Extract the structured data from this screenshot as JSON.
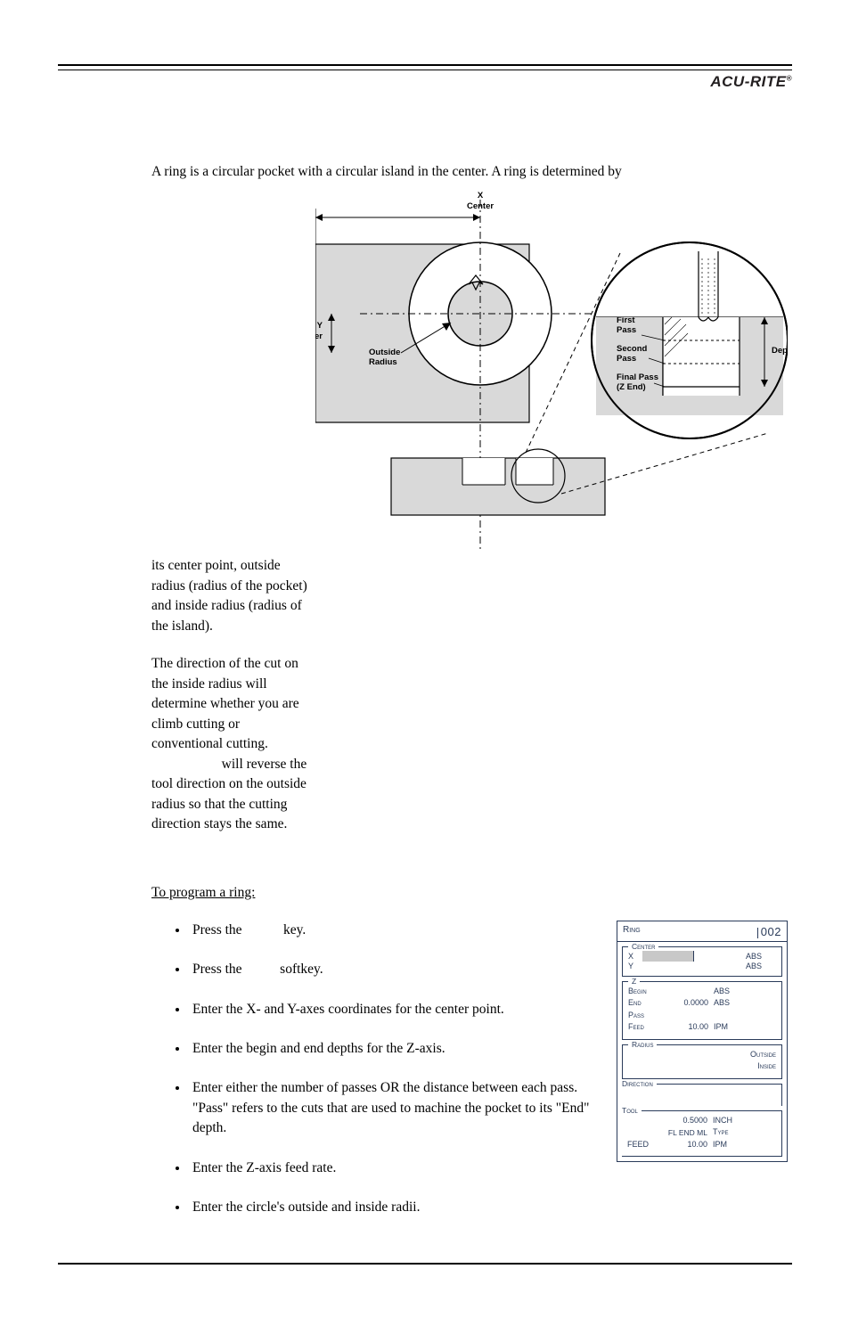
{
  "brand": "ACU-RITE",
  "intro_first_line": "A ring is a circular pocket with a circular island in the center. A ring is determined by",
  "left_col": {
    "p1": "its center point, outside radius (radius of the pocket) and inside radius (radius of the island).",
    "p2a": "The direction of the cut on the inside radius will determine whether you are climb cutting or conventional cutting.",
    "p2b": " will reverse the tool direction on the outside radius so that the cutting direction stays the same."
  },
  "figure": {
    "x_center": "X Center",
    "y_center": "Y Center",
    "outside_radius": "Outside Radius",
    "first_pass": "First Pass",
    "second_pass": "Second Pass",
    "final_pass_a": "Final Pass",
    "final_pass_b": "(Z End)",
    "depth": "Depth"
  },
  "program_head": "To program a ring:",
  "steps": [
    "Press the            key.",
    "Press the           softkey.",
    "Enter the X- and Y-axes coordinates for the center point.",
    "Enter the begin and end depths for the Z-axis.",
    "Enter either the number of passes OR the distance between each pass. \"Pass\" refers to the cuts that are used to machine the pocket to its \"End\" depth.",
    "Enter the Z-axis feed rate.",
    "Enter the circle's outside and inside radii."
  ],
  "panel": {
    "title": "Ring",
    "num": "002",
    "center": {
      "legend": "Center",
      "x": "X",
      "y": "Y",
      "abs": "ABS"
    },
    "z": {
      "legend": "Z",
      "begin": "Begin",
      "begin_suf": "ABS",
      "end": "End",
      "end_val": "0.0000",
      "end_suf": "ABS",
      "pass": "Pass",
      "feed": "Feed",
      "feed_val": "10.00",
      "feed_suf": "IPM"
    },
    "radius": {
      "legend": "Radius",
      "outside": "Outside",
      "inside": "Inside"
    },
    "direction": {
      "legend": "Direction"
    },
    "tool": {
      "legend": "Tool",
      "dia_val": "0.5000",
      "dia_unit": "INCH",
      "type_val": "FL END ML",
      "type_lbl": "Type",
      "feed": "FEED",
      "feed_val": "10.00",
      "feed_unit": "IPM"
    }
  }
}
